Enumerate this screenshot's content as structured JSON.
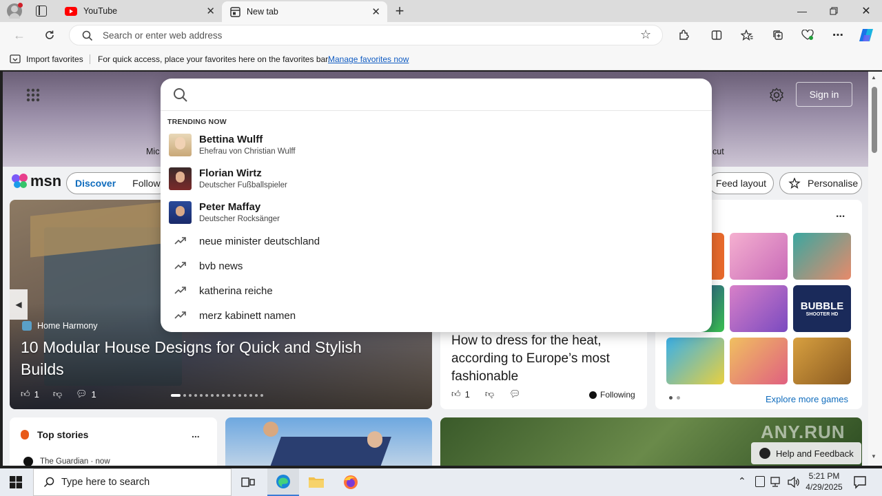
{
  "browser": {
    "tabs": [
      {
        "label": "YouTube",
        "icon": "youtube-icon"
      },
      {
        "label": "New tab",
        "icon": "newtab-icon"
      }
    ],
    "address_placeholder": "Search or enter web address",
    "favorites_bar": {
      "import_label": "Import favorites",
      "hint": "For quick access, place your favorites here on the favorites bar.",
      "manage_link": "Manage favorites now"
    }
  },
  "msn": {
    "logo": "msn",
    "nav": {
      "discover": "Discover",
      "following": "Followin"
    },
    "sign_in": "Sign in",
    "feed_layout": "Feed layout",
    "personalise": "Personalise",
    "hero_left_edge_text": "Mic",
    "hero_right_edge_text": "cut",
    "hero_story": {
      "source": "Home Harmony",
      "title": "10 Modular House Designs for Quick and Stylish Builds",
      "likes": "1",
      "comments": "1"
    },
    "second_story": {
      "title": "How to dress for the heat, according to Europe’s most fashionable",
      "likes": "1",
      "following": "Following"
    },
    "games": {
      "more": "...",
      "explore": "Explore more games",
      "bubble_title": "BUBBLE",
      "bubble_sub": "SHOOTER HD"
    },
    "top_stories": {
      "title": "Top stories",
      "more": "...",
      "first_source": "The Guardian · now"
    },
    "help_feedback": "Help and Feedback"
  },
  "search_dropdown": {
    "heading": "TRENDING NOW",
    "people": [
      {
        "name": "Bettina Wulff",
        "desc": "Ehefrau von Christian Wulff"
      },
      {
        "name": "Florian Wirtz",
        "desc": "Deutscher Fußballspieler"
      },
      {
        "name": "Peter Maffay",
        "desc": "Deutscher Rocksänger"
      }
    ],
    "trends": [
      "neue minister deutschland",
      "bvb news",
      "katherina reiche",
      "merz kabinett namen"
    ]
  },
  "taskbar": {
    "search_placeholder": "Type here to search",
    "time": "5:21 PM",
    "date": "4/29/2025"
  },
  "watermark": "ANY.RUN",
  "colors": {
    "accent": "#0f5bc2",
    "youtube_red": "#ff0000",
    "msn_blue": "#0f6cbd"
  }
}
